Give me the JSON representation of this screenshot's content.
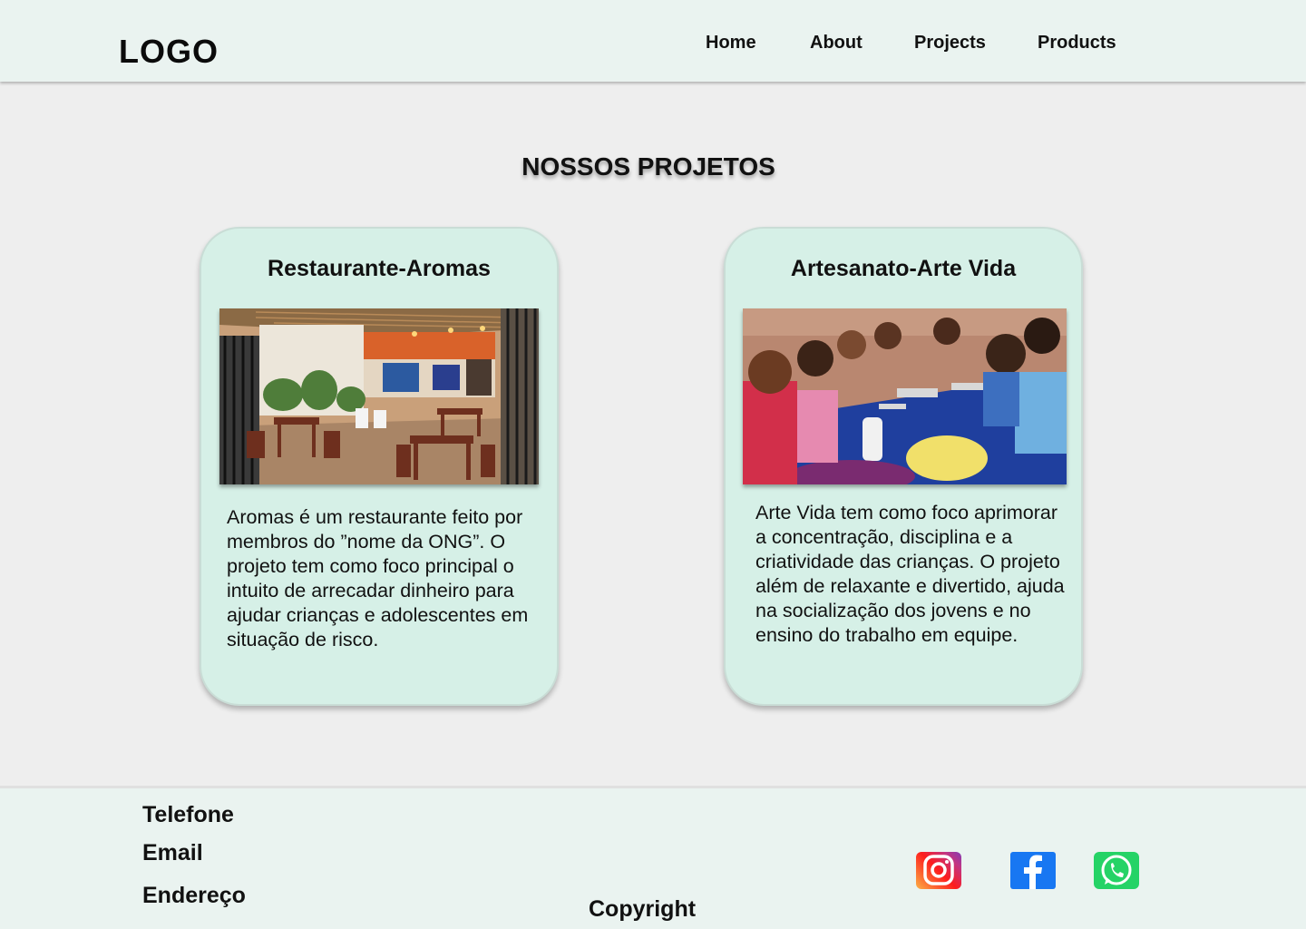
{
  "header": {
    "logo": "LOGO",
    "nav": [
      "Home",
      "About",
      "Projects",
      "Products"
    ]
  },
  "main": {
    "title": "NOSSOS PROJETOS",
    "projects": [
      {
        "title": "Restaurante-Aromas",
        "description": "Aromas é um restaurante feito por membros do ”nome da ONG”. O projeto tem como foco principal o intuito de arrecadar dinheiro para ajudar crianças e adolescentes em situação de risco."
      },
      {
        "title": "Artesanato-Arte Vida",
        "description": "Arte Vida tem como foco aprimorar a concentração, disciplina e a criatividade das crianças. O projeto além de relaxante e divertido, ajuda na socialização dos jovens e no ensino do trabalho em equipe."
      }
    ]
  },
  "footer": {
    "phone_label": "Telefone",
    "email_label": "Email",
    "address_label": "Endereço",
    "copyright": "Copyright",
    "social": [
      {
        "icon": "instagram-icon",
        "color": "#e1306c"
      },
      {
        "icon": "facebook-icon",
        "color": "#1877f2"
      },
      {
        "icon": "whatsapp-icon",
        "color": "#25d366"
      }
    ]
  },
  "colors": {
    "header_bg": "#eaf3f0",
    "page_bg": "#eeeeee",
    "card_bg": "#d6f0e7"
  }
}
